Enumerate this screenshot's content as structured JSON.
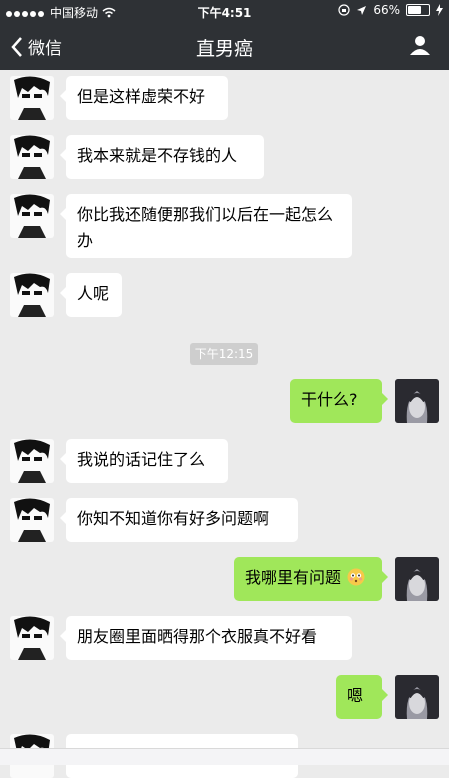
{
  "status_bar": {
    "carrier": "中国移动",
    "time": "下午4:51",
    "battery": "66%",
    "battery_level": 0.66
  },
  "nav": {
    "back_label": "微信",
    "title": "直男癌"
  },
  "timestamp": "下午12:15",
  "messages": [
    {
      "side": "in",
      "text": "但是这样虚荣不好"
    },
    {
      "side": "in",
      "text": "我本来就是不存钱的人"
    },
    {
      "side": "in",
      "text": "你比我还随便那我们以后在一起怎么办"
    },
    {
      "side": "in",
      "text": "人呢"
    },
    {
      "side": "out",
      "text": "干什么?"
    },
    {
      "side": "in",
      "text": "我说的话记住了么"
    },
    {
      "side": "in",
      "text": "你知不知道你有好多问题啊"
    },
    {
      "side": "out",
      "text": "我哪里有问题"
    },
    {
      "side": "in",
      "text": "朋友圈里面晒得那个衣服真不好看"
    },
    {
      "side": "out",
      "text": "嗯"
    }
  ],
  "icons": {
    "back": "chevron-left-icon",
    "profile": "person-icon",
    "wifi": "wifi-icon",
    "lock": "orientation-lock-icon",
    "location": "location-arrow-icon",
    "battery": "battery-icon",
    "charging": "charging-bolt-icon",
    "emoji": "flushed-face-emoji"
  }
}
